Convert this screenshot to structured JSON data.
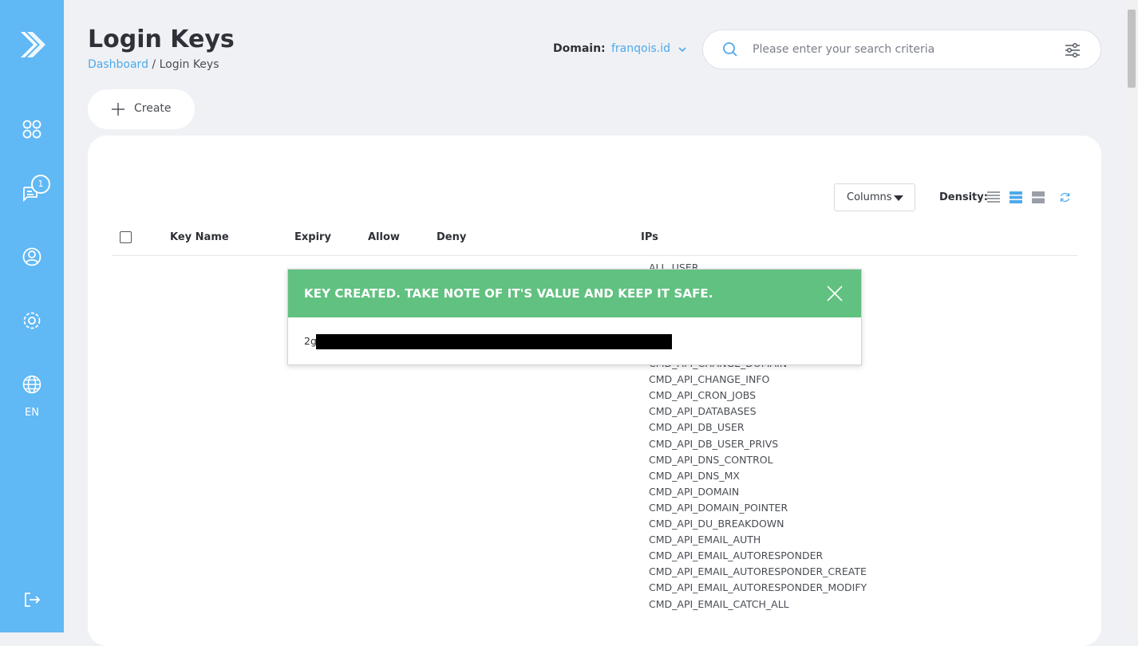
{
  "sidebar": {
    "logo_icon": "chevron-logo-icon",
    "items": [
      {
        "name": "dashboard",
        "icon": "grid-icon"
      },
      {
        "name": "messages",
        "icon": "chat-icon",
        "badge": "1"
      },
      {
        "name": "account",
        "icon": "user-icon"
      },
      {
        "name": "settings",
        "icon": "gear-icon"
      },
      {
        "name": "language",
        "icon": "globe-icon",
        "label": "EN"
      },
      {
        "name": "logout",
        "icon": "logout-icon"
      }
    ],
    "color": "#60b8f5"
  },
  "header": {
    "title": "Login Keys",
    "breadcrumb": {
      "link": "Dashboard",
      "separator": " / ",
      "current": "Login Keys"
    },
    "domain_label": "Domain:",
    "domain_value": "franqois.id",
    "search_placeholder": "Please enter your search criteria"
  },
  "toolbar": {
    "create_label": "Create"
  },
  "table": {
    "columns_button": "Columns",
    "density_label": "Density:",
    "density_options": [
      "compact",
      "standard",
      "comfortable"
    ],
    "density_selected": "standard",
    "headers": [
      "Key Name",
      "Expiry",
      "Allow",
      "Deny",
      "IPs"
    ],
    "allow_values": [
      "ALL_USER",
      "CMD_API_CHANGE_DOMAIN",
      "CMD_API_CHANGE_INFO",
      "CMD_API_CRON_JOBS",
      "CMD_API_DATABASES",
      "CMD_API_DB_USER",
      "CMD_API_DB_USER_PRIVS",
      "CMD_API_DNS_CONTROL",
      "CMD_API_DNS_MX",
      "CMD_API_DOMAIN",
      "CMD_API_DOMAIN_POINTER",
      "CMD_API_DU_BREAKDOWN",
      "CMD_API_EMAIL_AUTH",
      "CMD_API_EMAIL_AUTORESPONDER",
      "CMD_API_EMAIL_AUTORESPONDER_CREATE",
      "CMD_API_EMAIL_AUTORESPONDER_MODIFY",
      "CMD_API_EMAIL_CATCH_ALL"
    ]
  },
  "modal": {
    "title": "KEY CREATED. TAKE NOTE OF IT'S VALUE AND KEEP IT SAFE.",
    "key_prefix": "2g",
    "header_color": "#61c180"
  },
  "colors": {
    "accent": "#4ea9ea",
    "success": "#61c180",
    "background": "#eff1f5"
  }
}
